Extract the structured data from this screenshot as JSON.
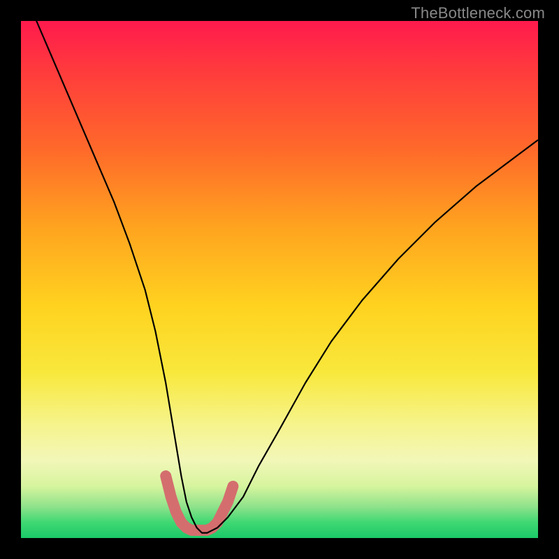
{
  "watermark": "TheBottleneck.com",
  "chart_data": {
    "type": "line",
    "title": "",
    "xlabel": "",
    "ylabel": "",
    "xlim": [
      0,
      100
    ],
    "ylim": [
      0,
      100
    ],
    "series": [
      {
        "name": "bottleneck-curve",
        "x": [
          0,
          3,
          6,
          9,
          12,
          15,
          18,
          21,
          24,
          26,
          28,
          29,
          30,
          31,
          32,
          33,
          34,
          35,
          36,
          38,
          40,
          43,
          46,
          50,
          55,
          60,
          66,
          73,
          80,
          88,
          96,
          100
        ],
        "values": [
          107,
          100,
          93,
          86,
          79,
          72,
          65,
          57,
          48,
          40,
          30,
          24,
          18,
          12,
          7,
          4,
          2,
          1,
          1,
          2,
          4,
          8,
          14,
          21,
          30,
          38,
          46,
          54,
          61,
          68,
          74,
          77
        ]
      },
      {
        "name": "highlight-band",
        "x": [
          28,
          29,
          30,
          31,
          32,
          33,
          34,
          35,
          36,
          37,
          38,
          39,
          40,
          41
        ],
        "values": [
          12,
          8,
          5,
          3,
          2,
          1.5,
          1.5,
          1.5,
          1.5,
          2,
          3,
          5,
          7,
          10
        ]
      }
    ],
    "colors": {
      "curve": "#000000",
      "highlight": "#d46e6e",
      "gradient_top": "#ff1a4d",
      "gradient_bottom": "#1bc968"
    }
  }
}
